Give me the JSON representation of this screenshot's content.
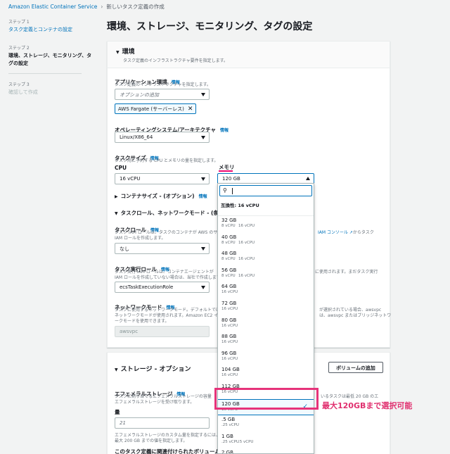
{
  "breadcrumb": {
    "service": "Amazon Elastic Container Service",
    "current": "新しいタスク定義の作成"
  },
  "steps": [
    {
      "num": "ステップ 1",
      "label": "タスク定義とコンテナの設定"
    },
    {
      "num": "ステップ 2",
      "label": "環境、ストレージ、モニタリング、タグの設定"
    },
    {
      "num": "ステップ 3",
      "label": "確認して作成"
    }
  ],
  "page_title": "環境、ストレージ、モニタリング、タグの設定",
  "environment": {
    "title": "環境",
    "desc": "タスク定義のインフラストラクチャ要件を指定します。",
    "app_env_label": "アプリケーション環境",
    "app_env_info": "情報",
    "app_env_desc": "タスク定義のインフラストラクチャを指定します。",
    "app_env_placeholder": "オプションの追加",
    "app_env_token": "AWS Fargate (サーバーレス)",
    "os_label": "オペレーティングシステム/アーキテクチャ",
    "os_info": "情報",
    "os_value": "Linux/X86_64",
    "task_size_label": "タスクサイズ",
    "task_size_info": "情報",
    "task_size_desc": "タスク用に予約する CPU とメモリの量を指定します。",
    "cpu_label": "CPU",
    "cpu_value": "16 vCPU",
    "memory_label": "メモリ",
    "memory_value": "120 GB",
    "container_size": "コンテナサイズ - (オプション)",
    "container_size_info": "情報",
    "task_role_section": "タスクロール、ネットワークモード - (条件付き)",
    "task_role_label": "タスクロール",
    "task_role_info": "情報",
    "task_role_desc1": "タスク IAM ロールは、タスクのコンテナが AWS のサ",
    "task_role_desc2": "IAM ロールを作成します。",
    "iam_console": "IAM コンソール",
    "iam_console_suffix": "からタスク",
    "task_role_value": "なし",
    "exec_role_label": "タスク実行ロール",
    "exec_role_info": "情報",
    "exec_role_desc1": "タスク実行 IAM ロールは、コンテナエージェントが",
    "exec_role_desc2": "IAM ロールを作成していない場合は、当社で作成します",
    "exec_role_desc_right1": "に使用されます。まだタスク実行",
    "exec_role_value": "ecsTaskExecutionRole",
    "network_label": "ネットワークモード",
    "network_info": "情報",
    "network_desc1": "タスクに使用するネットワークモード。デフォルトでは",
    "network_desc2": "ネットワークモードが使用されます。Amazon EC2 イ",
    "network_desc3": "ークモードを使用できます。",
    "network_desc_right1": "が選択されている場合、awsvpc",
    "network_desc_right2": "は、awsvpc またはブリッジネットワ",
    "network_value": "awsvpc"
  },
  "storage": {
    "title": "ストレージ - オプション",
    "add_volume": "ボリュームの追加",
    "ephemeral_label": "エフェメラルストレージ",
    "ephemeral_info": "情報",
    "ephemeral_desc1": "タスクに割り当てるエフェメラルストレージの容量",
    "ephemeral_desc2": "エフェメラルストレージを受け取ります。",
    "ephemeral_desc_right1": "いるタスクは最低 20 GB のエ",
    "amount_label": "量",
    "amount_value": "21",
    "custom_desc1": "エフェメラルストレージのカスタム量を指定するには、",
    "custom_desc2": "最大 200 GB までの値を指定します。",
    "volume_desc": "このタスク定義に関連付けられたボリュームが"
  },
  "memory_dropdown": {
    "group": "互換性: 16 vCPU",
    "options": [
      {
        "label": "32 GB",
        "a": "8 vCPU",
        "b": "16 vCPU"
      },
      {
        "label": "40 GB",
        "a": "8 vCPU",
        "b": "16 vCPU"
      },
      {
        "label": "48 GB",
        "a": "8 vCPU",
        "b": "16 vCPU"
      },
      {
        "label": "56 GB",
        "a": "8 vCPU",
        "b": "16 vCPU"
      },
      {
        "label": "64 GB",
        "a": "16 vCPU",
        "b": ""
      },
      {
        "label": "72 GB",
        "a": "16 vCPU",
        "b": ""
      },
      {
        "label": "80 GB",
        "a": "16 vCPU",
        "b": ""
      },
      {
        "label": "88 GB",
        "a": "16 vCPU",
        "b": ""
      },
      {
        "label": "96 GB",
        "a": "16 vCPU",
        "b": ""
      },
      {
        "label": "104 GB",
        "a": "16 vCPU",
        "b": ""
      },
      {
        "label": "112 GB",
        "a": "16 vCPU",
        "b": ""
      },
      {
        "label": "120 GB",
        "a": "16 vCPU",
        "b": ""
      },
      {
        "label": ".5 GB",
        "a": ".25 vCPU",
        "b": ""
      },
      {
        "label": "1 GB",
        "a": ".25 vCPU",
        "b": ".5 vCPU"
      },
      {
        "label": "2 GB",
        "a": "",
        "b": ""
      }
    ],
    "selected_index": 11
  },
  "annotation": "最大120GBまで選択可能",
  "colors": {
    "link": "#0073bb",
    "highlight": "#e6337a"
  }
}
